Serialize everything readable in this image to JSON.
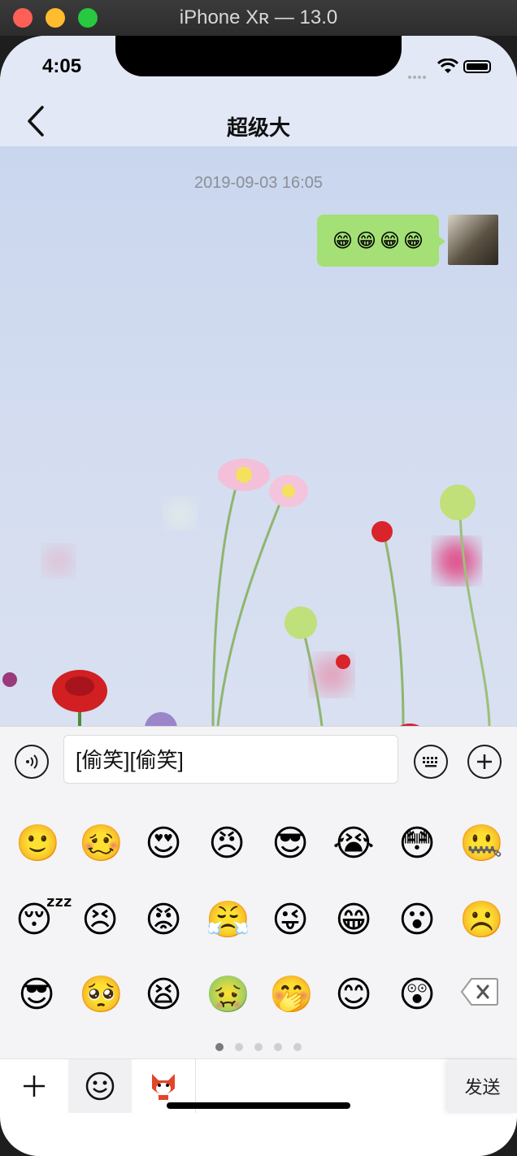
{
  "window": {
    "title": "iPhone Xʀ — 13.0"
  },
  "status": {
    "time": "4:05"
  },
  "nav": {
    "title": "超级大"
  },
  "chat": {
    "timestamp": "2019-09-03 16:05",
    "message": {
      "content": [
        "😁",
        "😁",
        "😁",
        "😁"
      ]
    }
  },
  "input": {
    "value": "[偷笑][偷笑]"
  },
  "emoji_panel": {
    "emojis": [
      "🙂",
      "🥴",
      "😍",
      "😠",
      "😎",
      "😭",
      "😳",
      "🤐",
      "😴",
      "😣",
      "😡",
      "😤",
      "😜",
      "😁",
      "😮",
      "☹️",
      "😎",
      "🥺",
      "😫",
      "🤢",
      "🤭",
      "😊",
      "😲"
    ],
    "page_count": 5,
    "active_page": 1
  },
  "tabs": {
    "send_label": "发送"
  },
  "icons": {
    "back": "chevron-left-icon",
    "voice": "voice-icon",
    "keyboard": "keyboard-icon",
    "add": "plus-circle-icon",
    "delete": "backspace-icon",
    "tab_add": "plus-icon",
    "tab_emoji": "smiley-icon",
    "tab_sticker": "fox-sticker-icon"
  },
  "colors": {
    "bubble": "#a4e075",
    "header": "#e3e8f6"
  }
}
